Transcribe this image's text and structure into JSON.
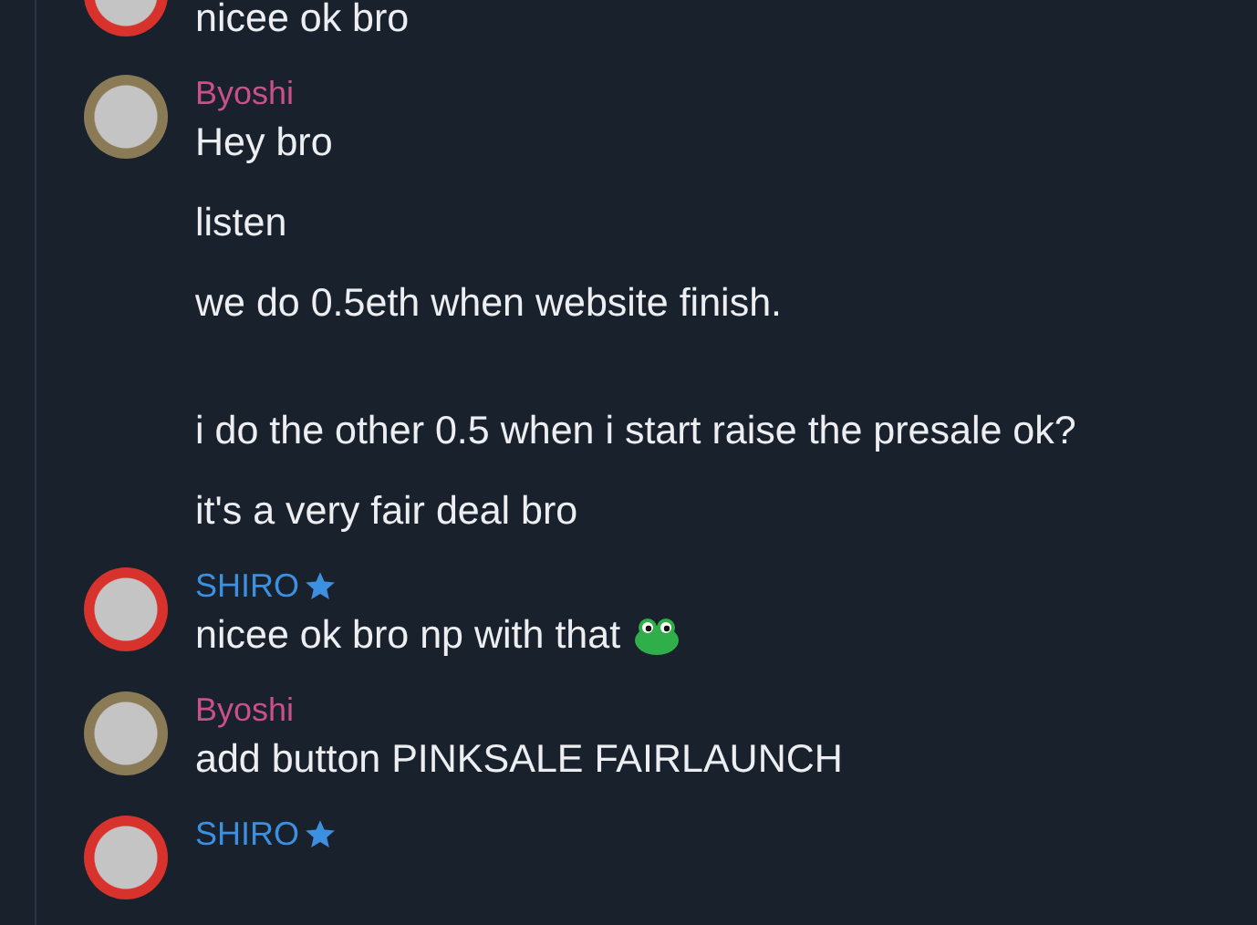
{
  "groups": [
    {
      "color": "#d8322c",
      "messages": [
        {
          "text": "nicee ok bro",
          "emoji": false
        }
      ]
    },
    {
      "author": {
        "name": "Byoshi",
        "color": "#c9508a",
        "verified": false
      },
      "color": "#8a7a55",
      "messages": [
        {
          "text": "Hey bro",
          "emoji": false
        },
        {
          "text": "listen",
          "emoji": false
        },
        {
          "text": "we do 0.5eth when website finish.\n\n",
          "emoji": false
        },
        {
          "text": "i do the other 0.5 when i start raise the presale ok?",
          "emoji": false
        },
        {
          "text": "it's a very fair deal bro",
          "emoji": false
        }
      ]
    },
    {
      "author": {
        "name": "SHIRO",
        "color": "#3d8fe0",
        "verified": true
      },
      "color": "#d8322c",
      "messages": [
        {
          "text": "nicee ok bro np with that",
          "emoji": true
        }
      ]
    },
    {
      "author": {
        "name": "Byoshi",
        "color": "#c9508a",
        "verified": false
      },
      "color": "#8a7a55",
      "messages": [
        {
          "text": "add button PINKSALE FAIRLAUNCH",
          "emoji": false
        }
      ]
    },
    {
      "author": {
        "name": "SHIRO",
        "color": "#3d8fe0",
        "verified": true
      },
      "color": "#d8322c"
    }
  ]
}
